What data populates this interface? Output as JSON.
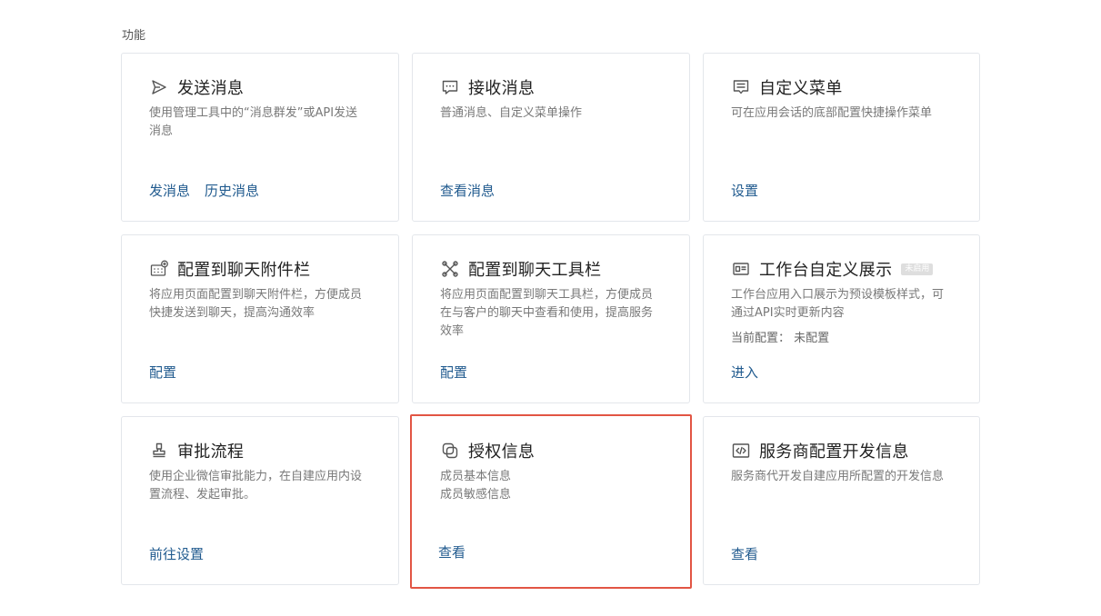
{
  "section": {
    "title": "功能"
  },
  "highlight_color": "#e25544",
  "link_color": "#215b8f",
  "cards": [
    {
      "title": "发送消息",
      "icon": "send-icon",
      "desc": [
        "使用管理工具中的“消息群发”或API发送",
        "消息"
      ],
      "links": [
        "发消息",
        "历史消息"
      ]
    },
    {
      "title": "接收消息",
      "icon": "chat-bubble-icon",
      "desc": [
        "普通消息、自定义菜单操作"
      ],
      "links": [
        "查看消息"
      ]
    },
    {
      "title": "自定义菜单",
      "icon": "menu-icon",
      "desc": [
        "可在应用会话的底部配置快捷操作菜单"
      ],
      "links": [
        "设置"
      ]
    },
    {
      "title": "配置到聊天附件栏",
      "icon": "keyboard-add-icon",
      "desc": [
        "将应用页面配置到聊天附件栏，方便成员",
        "快捷发送到聊天，提高沟通效率"
      ],
      "links": [
        "配置"
      ]
    },
    {
      "title": "配置到聊天工具栏",
      "icon": "tools-icon",
      "desc": [
        "将应用页面配置到聊天工具栏，方便成员",
        "在与客户的聊天中查看和使用，提高服务",
        "效率"
      ],
      "links": [
        "配置"
      ]
    },
    {
      "title": "工作台自定义展示",
      "badge": "未启用",
      "icon": "id-card-icon",
      "desc": [
        "工作台应用入口展示为预设模板样式，可",
        "通过API实时更新内容"
      ],
      "meta_label": "当前配置：",
      "meta_value": "未配置",
      "links": [
        "进入"
      ]
    },
    {
      "title": "审批流程",
      "icon": "stamp-icon",
      "desc": [
        "使用企业微信审批能力，在自建应用内设",
        "置流程、发起审批。"
      ],
      "links": [
        "前往设置"
      ]
    },
    {
      "title": "授权信息",
      "icon": "authorization-icon",
      "highlighted": true,
      "desc": [
        "成员基本信息",
        "成员敏感信息"
      ],
      "links": [
        "查看"
      ]
    },
    {
      "title": "服务商配置开发信息",
      "icon": "code-icon",
      "desc": [
        "服务商代开发自建应用所配置的开发信息"
      ],
      "links": [
        "查看"
      ]
    }
  ]
}
